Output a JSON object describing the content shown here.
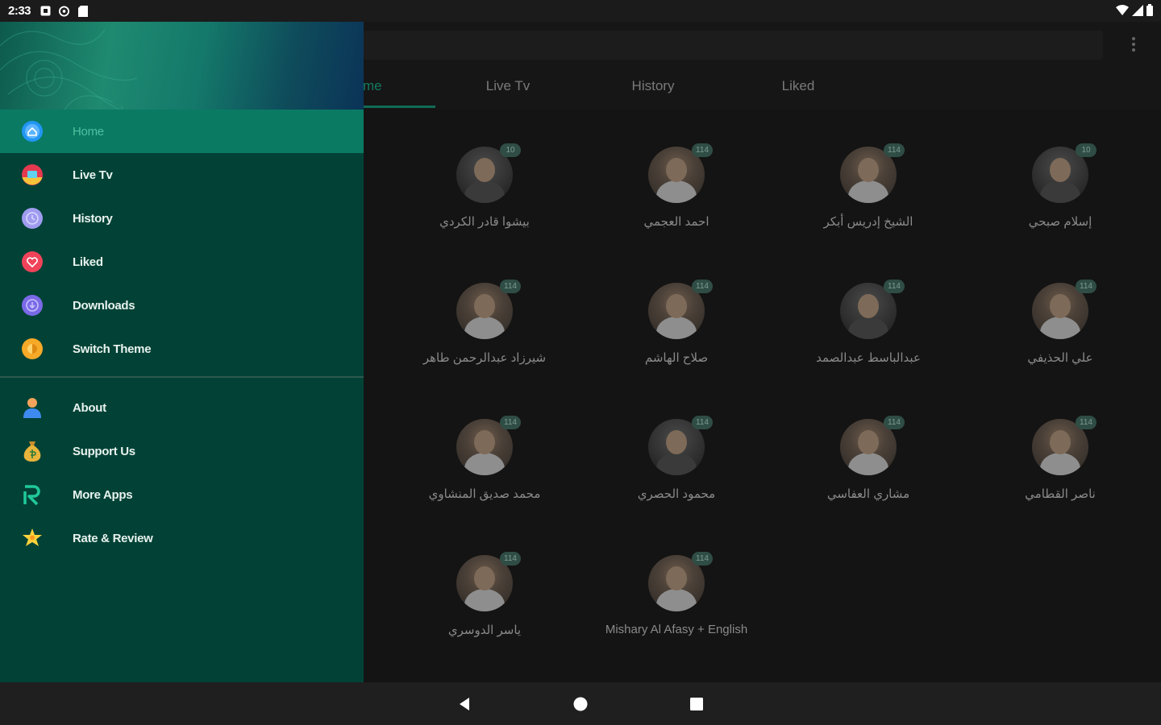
{
  "status_bar": {
    "time": "2:33"
  },
  "tabs": [
    {
      "label": "me",
      "active": true
    },
    {
      "label": "Live Tv",
      "active": false
    },
    {
      "label": "History",
      "active": false
    },
    {
      "label": "Liked",
      "active": false
    }
  ],
  "reciters": [
    {
      "name": "بيشوا قادر الكردي",
      "badge": "10"
    },
    {
      "name": "احمد العجمي",
      "badge": "114"
    },
    {
      "name": "الشيخ إدريس أبكر",
      "badge": "114"
    },
    {
      "name": "إسلام صبحي",
      "badge": "10"
    },
    {
      "name": "شيرزاد عبدالرحمن طاهر",
      "badge": "114"
    },
    {
      "name": "صلاح الهاشم",
      "badge": "114"
    },
    {
      "name": "عبدالباسط عبدالصمد",
      "badge": "114"
    },
    {
      "name": "علي الحذيفي",
      "badge": "114"
    },
    {
      "name": "محمد صديق المنشاوي",
      "badge": "114"
    },
    {
      "name": "محمود الحصري",
      "badge": "114"
    },
    {
      "name": "مشاري العفاسي",
      "badge": "114"
    },
    {
      "name": "ناصر القطامي",
      "badge": "114"
    },
    {
      "name": "ياسر الدوسري",
      "badge": "114"
    },
    {
      "name": "Mishary Al Afasy + English",
      "badge": "114"
    }
  ],
  "drawer": {
    "primary_items": [
      {
        "label": "Home",
        "icon": "home-icon",
        "color": "#2196f3",
        "active": true
      },
      {
        "label": "Live Tv",
        "icon": "tv-icon",
        "color": "#e53950",
        "active": false
      },
      {
        "label": "History",
        "icon": "history-icon",
        "color": "#9f9cf0",
        "active": false
      },
      {
        "label": "Liked",
        "icon": "heart-icon",
        "color": "#f0435a",
        "active": false
      },
      {
        "label": "Downloads",
        "icon": "download-icon",
        "color": "#7a6ae6",
        "active": false
      },
      {
        "label": "Switch Theme",
        "icon": "theme-icon",
        "color": "#f7a928",
        "active": false
      }
    ],
    "secondary_items": [
      {
        "label": "About",
        "icon": "user-icon",
        "color": "#3d8bf0"
      },
      {
        "label": "Support Us",
        "icon": "money-bag-icon",
        "color": "#e8b43c"
      },
      {
        "label": "More Apps",
        "icon": "brand-r-icon",
        "color": "#20c99a"
      },
      {
        "label": "Rate & Review",
        "icon": "star-icon",
        "color": "#ffd23c"
      }
    ]
  },
  "colors": {
    "drawer_bg": "#024236",
    "drawer_active": "#0a7a63",
    "accent": "#4fc1a0",
    "app_bg": "#141414"
  }
}
